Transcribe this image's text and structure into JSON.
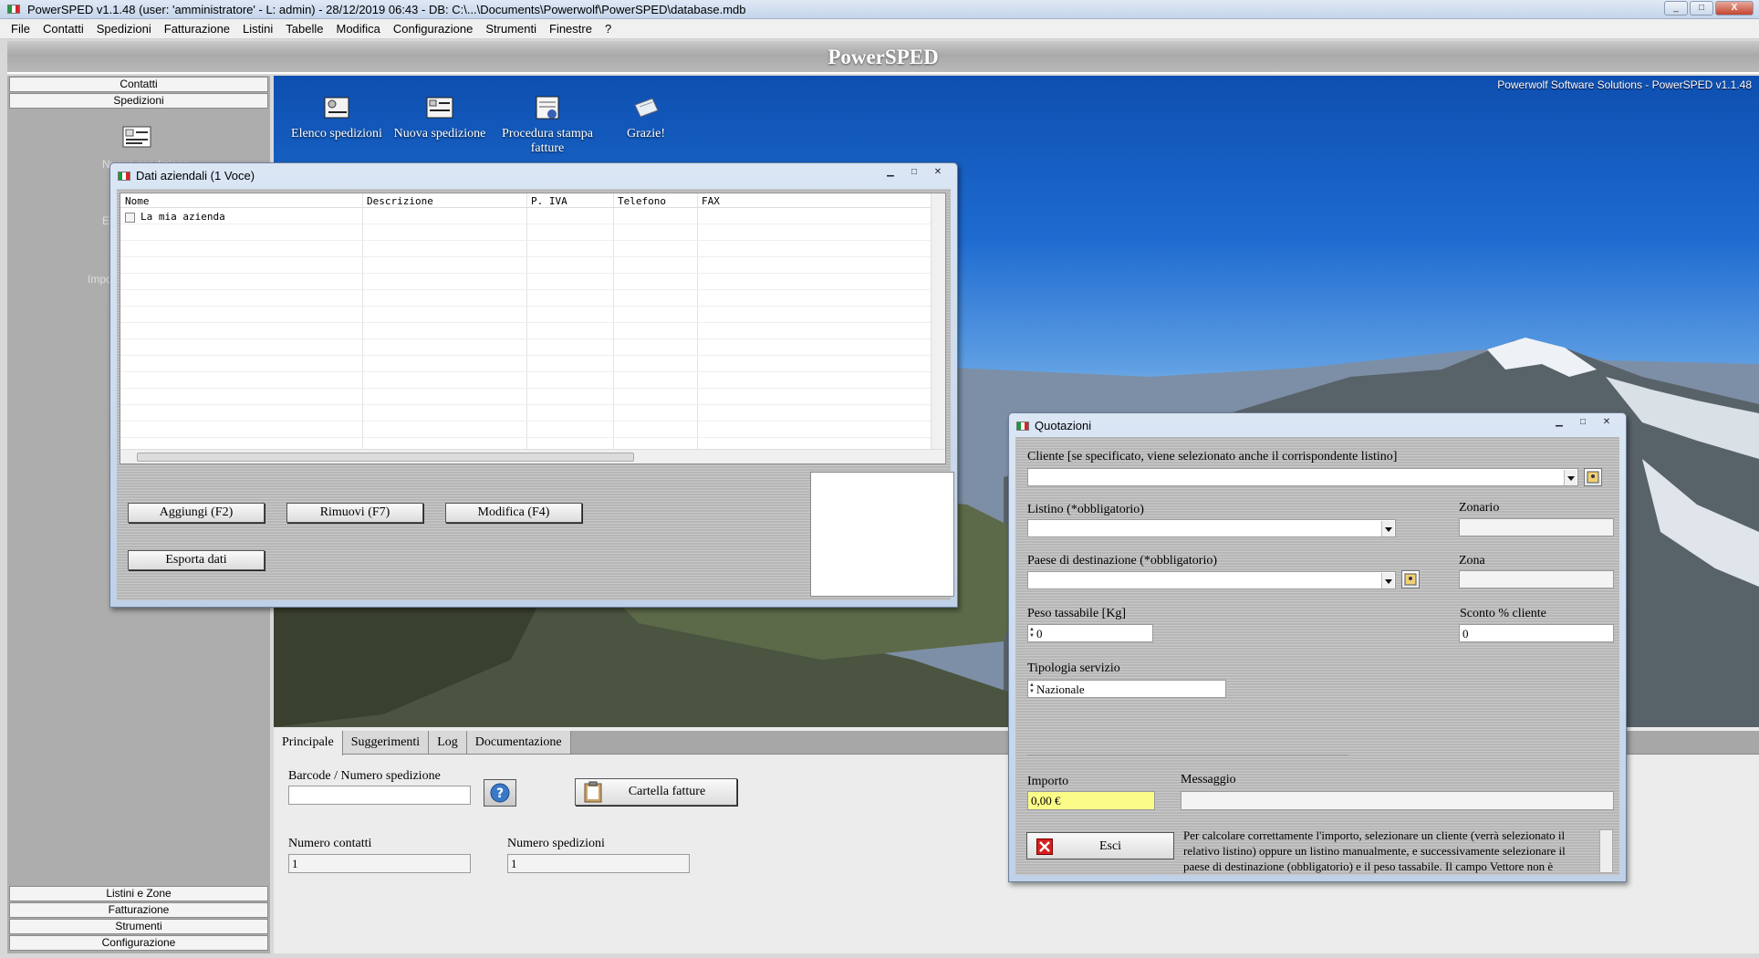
{
  "window": {
    "title": "PowerSPED v1.1.48  (user: 'amministratore'  - L: admin) - 28/12/2019 06:43 - DB: C:\\...\\Documents\\Powerwolf\\PowerSPED\\database.mdb",
    "min": "_",
    "max": "□",
    "close": "X"
  },
  "menu": [
    "File",
    "Contatti",
    "Spedizioni",
    "Fatturazione",
    "Listini",
    "Tabelle",
    "Modifica",
    "Configurazione",
    "Strumenti",
    "Finestre",
    "?"
  ],
  "app_header": {
    "name": "PowerSPED"
  },
  "sidebar": {
    "top": [
      "Contatti",
      "Spedizioni"
    ],
    "bottom": [
      "Listini e Zone",
      "Fatturazione",
      "Strumenti",
      "Configurazione"
    ],
    "ghost": [
      "Nuova spedizione",
      "El",
      "Impo"
    ]
  },
  "desktop": {
    "brand": "Powerwolf Software Solutions - PowerSPED v1.1.48",
    "items": [
      {
        "label": "Elenco spedizioni",
        "icon": "shipment-list-icon"
      },
      {
        "label": "Nuova spedizione",
        "icon": "new-shipment-icon"
      },
      {
        "label": "Procedura stampa fatture",
        "icon": "print-invoices-icon"
      },
      {
        "label": "Grazie!",
        "icon": "thanks-icon"
      }
    ]
  },
  "main": {
    "tabs": [
      "Principale",
      "Suggerimenti",
      "Log",
      "Documentazione"
    ],
    "barcode_label": "Barcode / Numero spedizione",
    "barcode_value": "",
    "folder_button": "Cartella fatture",
    "contacts_label": "Numero contatti",
    "contacts_value": "1",
    "shipments_label": "Numero spedizioni",
    "shipments_value": "1"
  },
  "dati_window": {
    "title": "Dati aziendali (1 Voce)",
    "columns": [
      "Nome",
      "Descrizione",
      "P. IVA",
      "Telefono",
      "FAX"
    ],
    "rows": [
      {
        "nome": "La mia azienda"
      }
    ],
    "buttons": {
      "add": "Aggiungi (F2)",
      "remove": "Rimuovi (F7)",
      "edit": "Modifica (F4)",
      "export": "Esporta dati"
    }
  },
  "quotazioni": {
    "title": "Quotazioni",
    "cliente_label": "Cliente [se specificato, viene selezionato anche il corrispondente listino]",
    "cliente_value": "",
    "listino_label": "Listino (*obbligatorio)",
    "listino_value": "",
    "zonario_label": "Zonario",
    "zonario_value": "",
    "paese_label": "Paese di destinazione (*obbligatorio)",
    "paese_value": "",
    "zona_label": "Zona",
    "zona_value": "",
    "peso_label": "Peso tassabile [Kg]",
    "peso_value": "0",
    "sconto_label": "Sconto % cliente",
    "sconto_value": "0",
    "tipologia_label": "Tipologia servizio",
    "tipologia_value": "Nazionale",
    "importo_label": "Importo",
    "importo_value": "0,00 €",
    "messaggio_label": "Messaggio",
    "messaggio_value": "",
    "esci_label": "Esci",
    "help_text": "Per calcolare correttamente l'importo, selezionare un cliente (verrà selezionato il relativo listino) oppure un listino manualmente, e successivamente selezionare il paese di destinazione (obbligatorio) e il peso tassabile. Il campo Vettore non è"
  },
  "colors": {
    "importo_bg": "#fbfb88",
    "window_title_bg": "#c8d8ec",
    "close_btn": "#c4442f"
  }
}
